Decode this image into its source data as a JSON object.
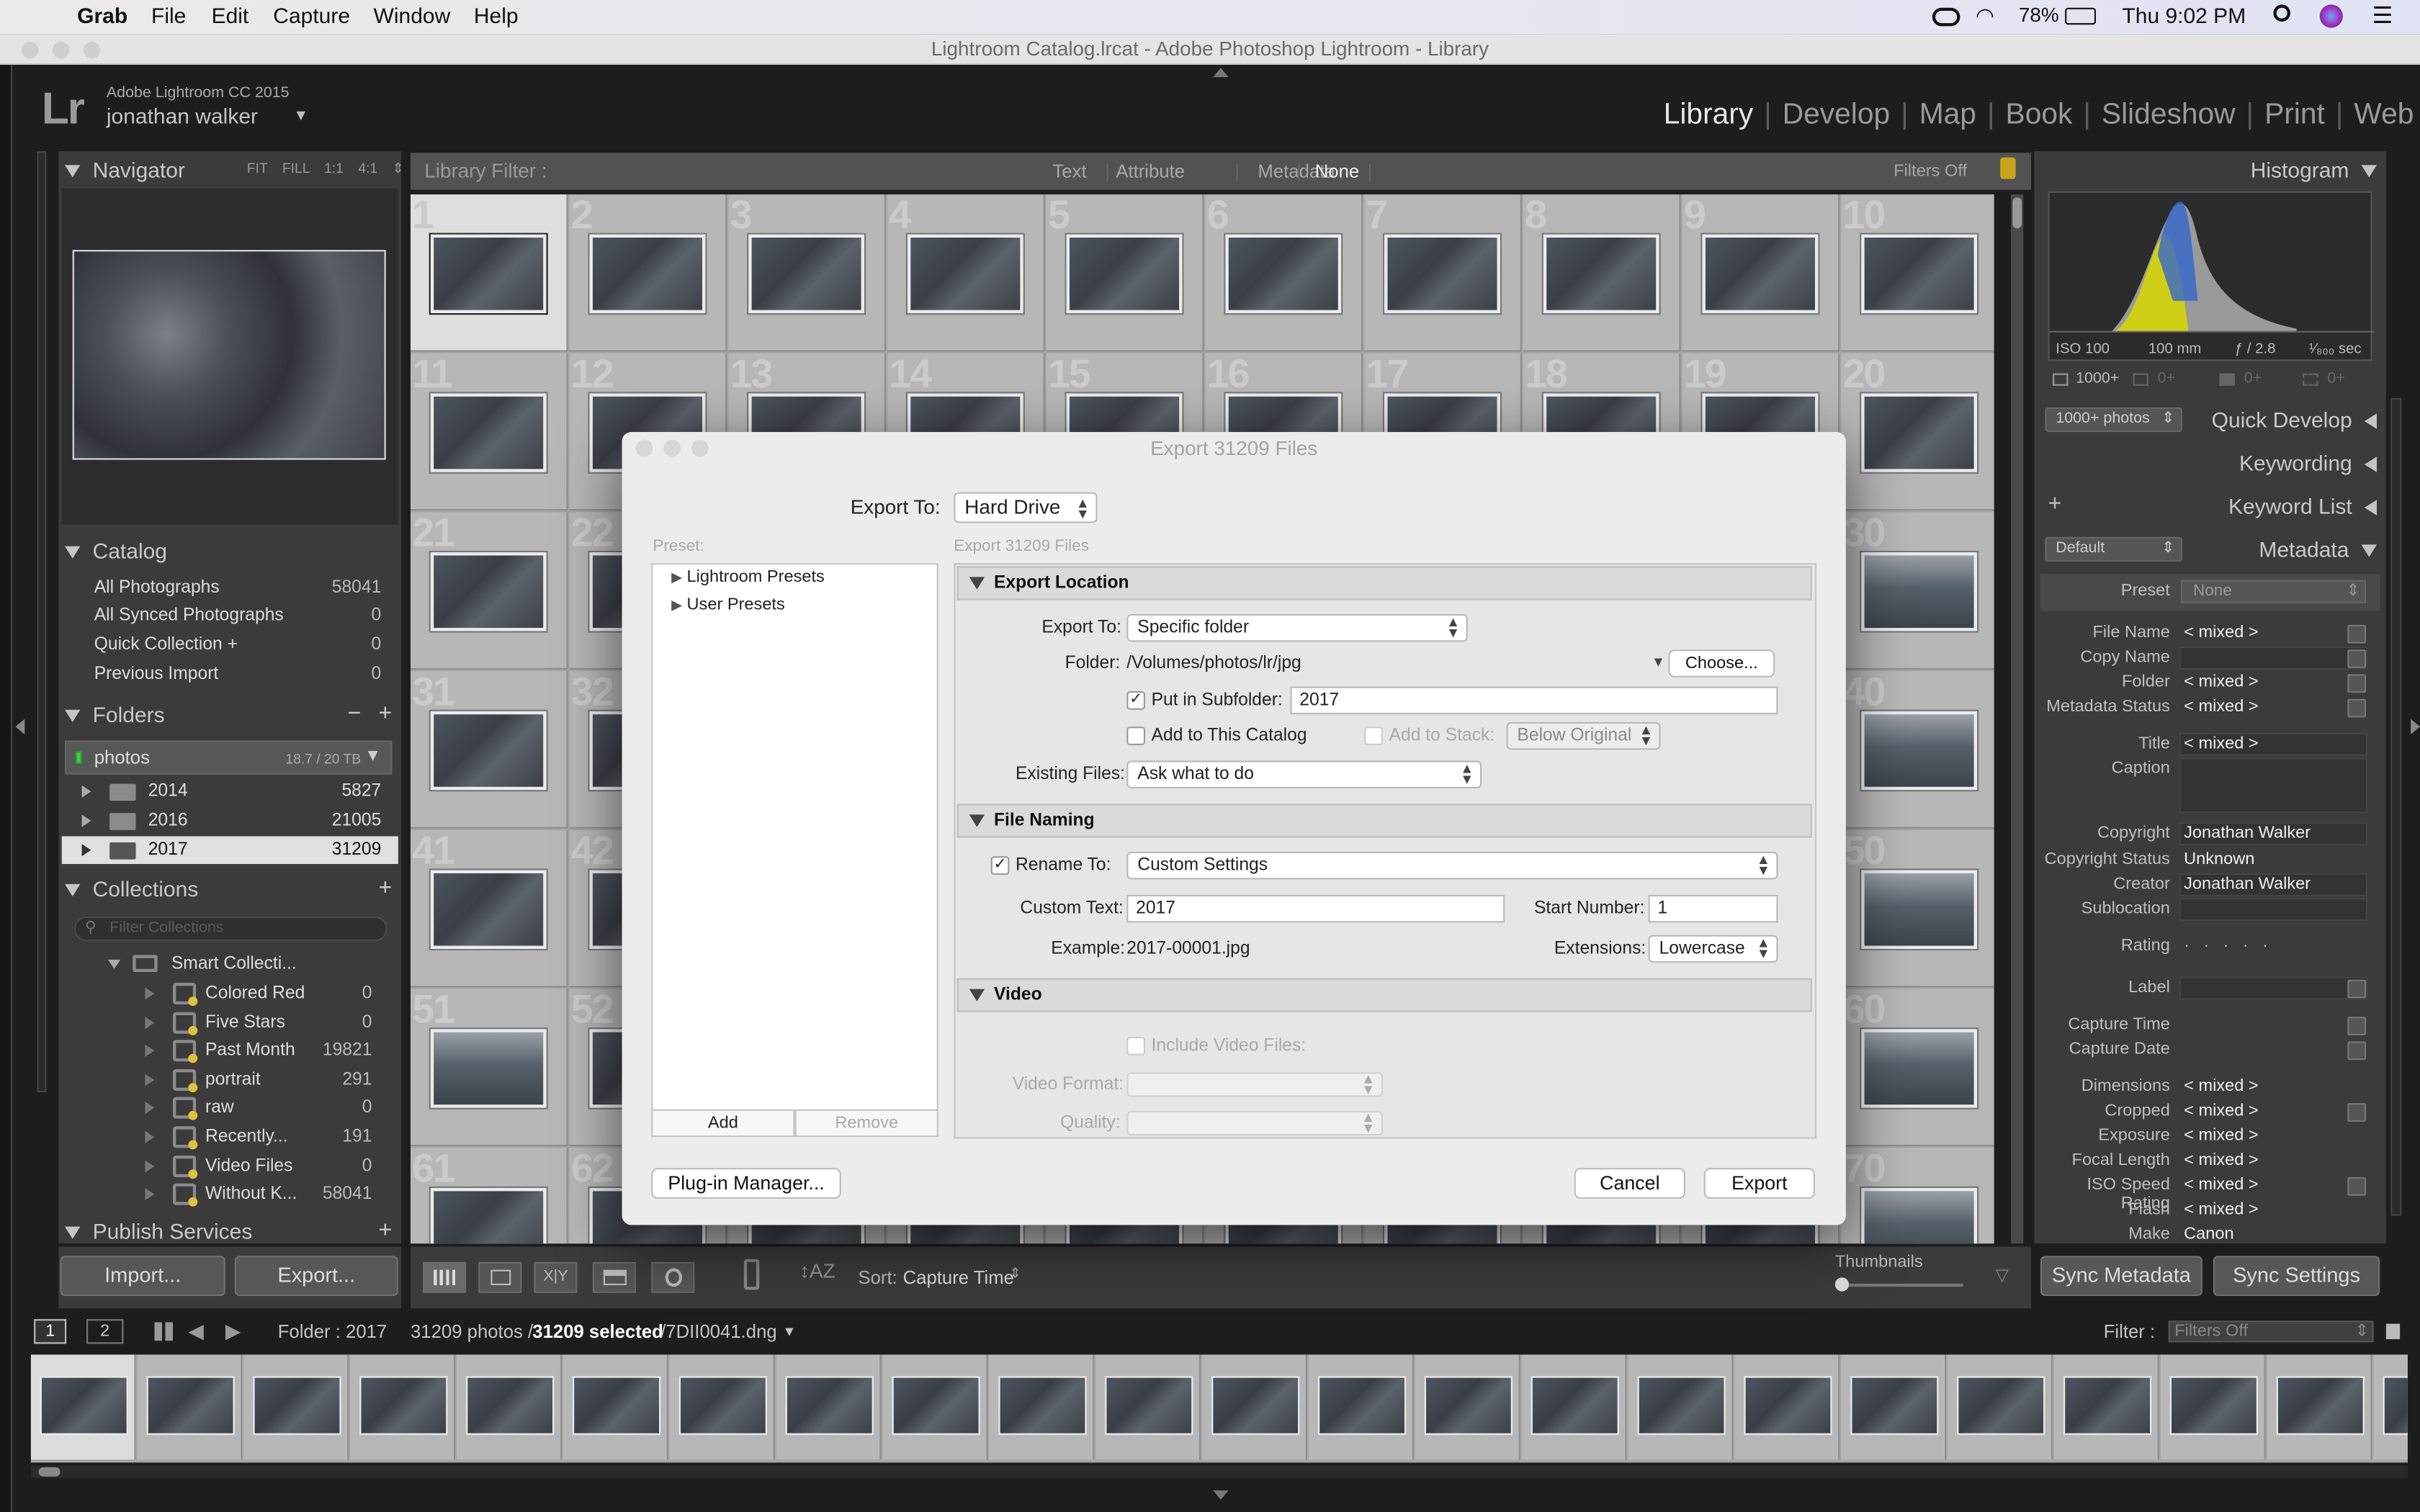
{
  "menubar": {
    "apple": "",
    "app": "Grab",
    "items": [
      "File",
      "Edit",
      "Capture",
      "Window",
      "Help"
    ],
    "battery": "78%",
    "clock": "Thu 9:02 PM"
  },
  "window": {
    "title": "Lightroom Catalog.lrcat - Adobe Photoshop Lightroom - Library"
  },
  "identity": {
    "logo": "Lr",
    "product": "Adobe Lightroom CC 2015",
    "user": "jonathan walker"
  },
  "modules": [
    "Library",
    "Develop",
    "Map",
    "Book",
    "Slideshow",
    "Print",
    "Web"
  ],
  "navigator": {
    "title": "Navigator",
    "zoom": [
      "FIT",
      "FILL",
      "1:1",
      "4:1"
    ]
  },
  "catalog": {
    "title": "Catalog",
    "items": [
      {
        "label": "All Photographs",
        "count": "58041"
      },
      {
        "label": "All Synced Photographs",
        "count": "0"
      },
      {
        "label": "Quick Collection +",
        "count": "0"
      },
      {
        "label": "Previous Import",
        "count": "0"
      }
    ]
  },
  "folders": {
    "title": "Folders",
    "volume": "photos",
    "volume_size": "18.7 / 20 TB",
    "items": [
      {
        "label": "2014",
        "count": "5827"
      },
      {
        "label": "2016",
        "count": "21005"
      },
      {
        "label": "2017",
        "count": "31209"
      }
    ]
  },
  "collections": {
    "title": "Collections",
    "filter_placeholder": "Filter Collections",
    "set": "Smart Collecti...",
    "items": [
      {
        "label": "Colored Red",
        "count": "0"
      },
      {
        "label": "Five Stars",
        "count": "0"
      },
      {
        "label": "Past Month",
        "count": "19821"
      },
      {
        "label": "portrait",
        "count": "291"
      },
      {
        "label": "raw",
        "count": "0"
      },
      {
        "label": "Recently...",
        "count": "191"
      },
      {
        "label": "Video Files",
        "count": "0"
      },
      {
        "label": "Without K...",
        "count": "58041"
      }
    ]
  },
  "publish": {
    "title": "Publish Services"
  },
  "left_buttons": {
    "import": "Import...",
    "export": "Export..."
  },
  "filterbar": {
    "label": "Library Filter :",
    "tabs": [
      "Text",
      "Attribute",
      "Metadata",
      "None"
    ],
    "filters_off": "Filters Off"
  },
  "grid": {
    "numbers": [
      "1",
      "2",
      "3",
      "4",
      "5",
      "6",
      "7",
      "8",
      "9",
      "10",
      "11",
      "12",
      "13",
      "14",
      "15",
      "16",
      "17",
      "18",
      "19",
      "20",
      "21",
      "22",
      "",
      "",
      "",
      "",
      "",
      "",
      "",
      "30",
      "31",
      "32",
      "",
      "",
      "",
      "",
      "",
      "",
      "",
      "40",
      "41",
      "42",
      "",
      "",
      "",
      "",
      "",
      "",
      "",
      "50",
      "51",
      "52",
      "",
      "",
      "",
      "",
      "",
      "",
      "",
      "60",
      "61",
      "62",
      "",
      "",
      "",
      "",
      "",
      "",
      "",
      "70"
    ]
  },
  "toolbar": {
    "sort_label": "Sort:",
    "sort_value": "Capture Time",
    "thumbnails": "Thumbnails"
  },
  "histogram": {
    "title": "Histogram",
    "iso": "ISO 100",
    "focal": "100 mm",
    "aperture": "ƒ / 2.8",
    "shutter": "¹⁄₈₀₀ sec",
    "count1": "1000+",
    "c2": "0+",
    "c3": "0+",
    "c4": "0+"
  },
  "right": {
    "photos_badge": "1000+ photos",
    "quick_develop": "Quick Develop",
    "keywording": "Keywording",
    "keyword_list": "Keyword List",
    "metadata_preset": "Default",
    "metadata": "Metadata",
    "preset_label": "Preset",
    "preset_value": "None"
  },
  "metadata": [
    {
      "label": "File Name",
      "value": "< mixed >"
    },
    {
      "label": "Copy Name",
      "value": ""
    },
    {
      "label": "Folder",
      "value": "< mixed >"
    },
    {
      "label": "Metadata Status",
      "value": "< mixed >"
    },
    {
      "label": "Title",
      "value": "< mixed >"
    },
    {
      "label": "Caption",
      "value": ""
    },
    {
      "label": "Copyright",
      "value": "Jonathan Walker"
    },
    {
      "label": "Copyright Status",
      "value": "Unknown"
    },
    {
      "label": "Creator",
      "value": "Jonathan Walker"
    },
    {
      "label": "Sublocation",
      "value": ""
    },
    {
      "label": "Rating",
      "value": "· · · · ·"
    },
    {
      "label": "Label",
      "value": ""
    },
    {
      "label": "Capture Time",
      "value": ""
    },
    {
      "label": "Capture Date",
      "value": ""
    },
    {
      "label": "Dimensions",
      "value": "< mixed >"
    },
    {
      "label": "Cropped",
      "value": "< mixed >"
    },
    {
      "label": "Exposure",
      "value": "< mixed >"
    },
    {
      "label": "Focal Length",
      "value": "< mixed >"
    },
    {
      "label": "ISO Speed Rating",
      "value": "< mixed >"
    },
    {
      "label": "Flash",
      "value": "< mixed >"
    },
    {
      "label": "Make",
      "value": "Canon"
    }
  ],
  "sync": {
    "metadata": "Sync Metadata",
    "settings": "Sync Settings"
  },
  "filmbar": {
    "p1": "1",
    "p2": "2",
    "folder": "Folder : 2017",
    "photos": "31209 photos /",
    "selected": "31209 selected",
    "file": "/7DII0041.dng",
    "filter_label": "Filter :",
    "filter_value": "Filters Off"
  },
  "dialog": {
    "title": "Export 31209 Files",
    "export_to_label": "Export To:",
    "export_to_value": "Hard Drive",
    "preset_label": "Preset:",
    "presets": [
      "Lightroom Presets",
      "User Presets"
    ],
    "add": "Add",
    "remove": "Remove",
    "subtitle": "Export 31209 Files",
    "location": {
      "title": "Export Location",
      "export_to_label": "Export To:",
      "export_to_value": "Specific folder",
      "folder_label": "Folder:",
      "folder_value": "/Volumes/photos/lr/jpg",
      "choose": "Choose...",
      "subfolder_check": "✓",
      "subfolder_label": "Put in Subfolder:",
      "subfolder_value": "2017",
      "add_catalog": "Add to This Catalog",
      "add_stack": "Add to Stack:",
      "stack_value": "Below Original",
      "existing_label": "Existing Files:",
      "existing_value": "Ask what to do"
    },
    "naming": {
      "title": "File Naming",
      "rename_check": "✓",
      "rename_label": "Rename To:",
      "rename_value": "Custom Settings",
      "custom_label": "Custom Text:",
      "custom_value": "2017",
      "start_label": "Start Number:",
      "start_value": "1",
      "example_label": "Example:",
      "example_value": "2017-00001.jpg",
      "ext_label": "Extensions:",
      "ext_value": "Lowercase"
    },
    "video": {
      "title": "Video",
      "include": "Include Video Files:",
      "format": "Video Format:",
      "quality": "Quality:"
    },
    "plugin": "Plug-in Manager...",
    "cancel": "Cancel",
    "export": "Export"
  }
}
